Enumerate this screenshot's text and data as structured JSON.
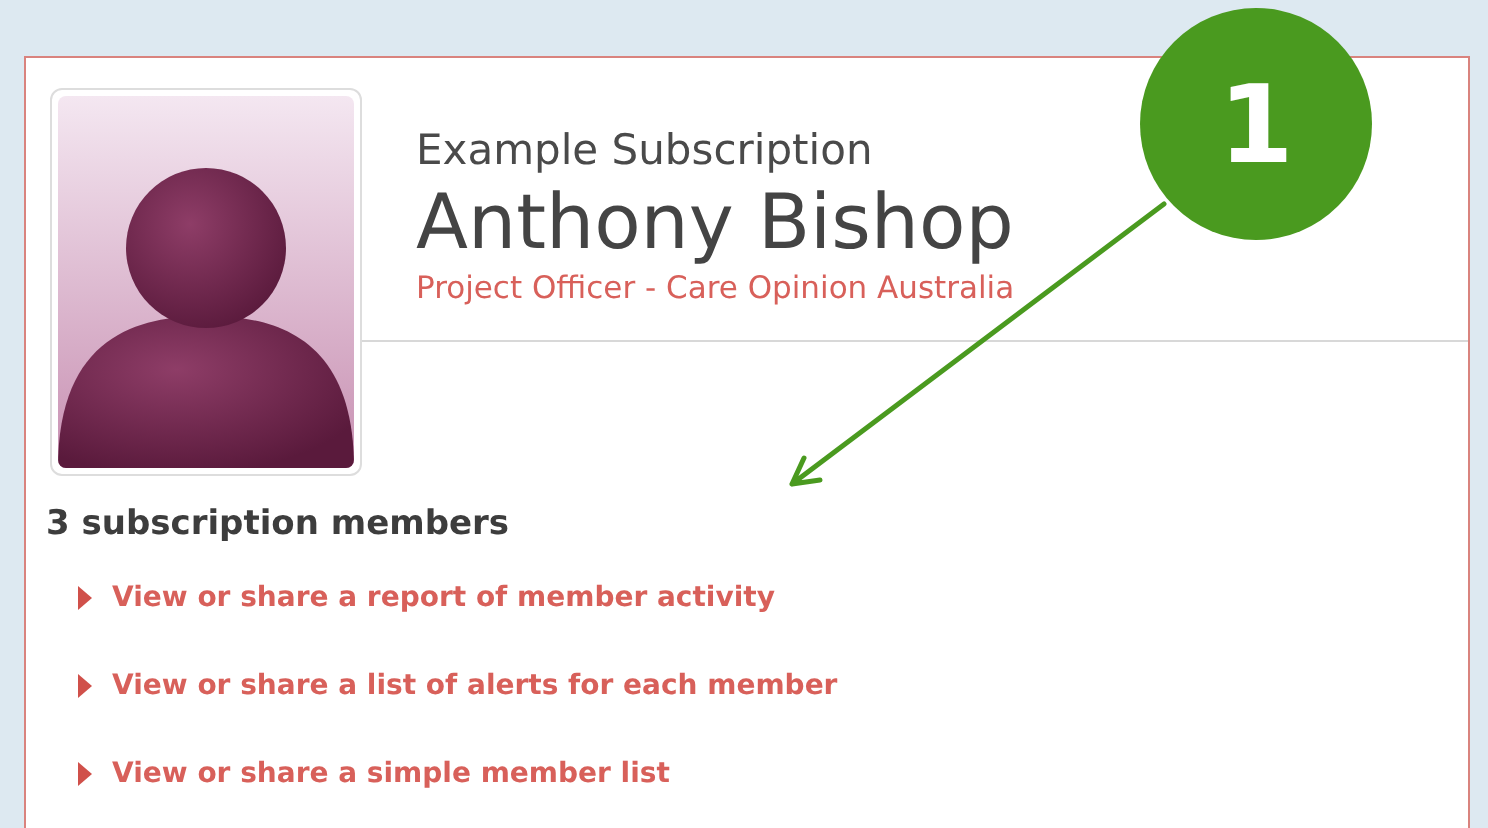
{
  "profile": {
    "subscription": "Example Subscription",
    "name": "Anthony Bishop",
    "role": "Project Officer - Care Opinion Australia"
  },
  "members": {
    "heading": "3 subscription members",
    "links": [
      {
        "label": "View or share a report of member activity"
      },
      {
        "label": "View or share a list of alerts for each member"
      },
      {
        "label": "View or share a simple member list"
      }
    ]
  },
  "callout": {
    "number": "1"
  }
}
